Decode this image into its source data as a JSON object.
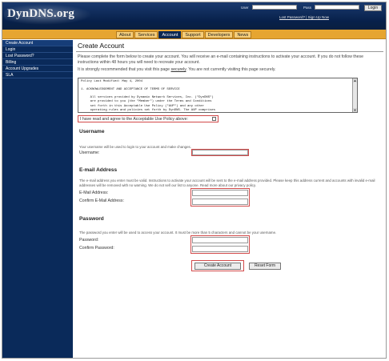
{
  "header": {
    "logo": "DynDNS.org",
    "login": {
      "user_label": "User",
      "pass_label": "Pass",
      "login_button": "Login",
      "links": "Lost Password? | Sign Up Now"
    }
  },
  "nav": {
    "tabs": [
      "About",
      "Services",
      "Account",
      "Support",
      "Developers",
      "News"
    ],
    "active": "Account"
  },
  "sidebar": {
    "items": [
      "Create Account",
      "Login",
      "Lost Password?",
      "Billing",
      "Account Upgrades",
      "SLA"
    ]
  },
  "main": {
    "title": "Create Account",
    "intro": "Please complete the form below to create your account. You will receive an e-mail containing instructions to activate your account. If you do not follow these instructions within 48 hours you will need to recreate your account.",
    "secure_before": "It is strongly recommended that you visit this page ",
    "secure_link": "securely",
    "secure_after": ". You are not currently visiting this page securely.",
    "policy_lines": [
      "Policy Last Modified: May 4, 2004",
      "",
      "1. ACKNOWLEDGEMENT AND ACCEPTANCE OF TERMS OF SERVICE",
      "",
      "     All services provided by Dynamic Network Services, Inc. (\"DynDNS\")",
      "     are provided to you (the \"Member\") under the Terms and Conditions",
      "     set forth in this Acceptable Use Policy (\"AUP\") and any other",
      "     operating rules and policies set forth by DynDNS. The AUP comprises"
    ],
    "agree_label": "I have read and agree to the Acceptable Use Policy above:",
    "username": {
      "heading": "Username",
      "desc": "Your username will be used to login to your account and make changes.",
      "label": "Username:"
    },
    "email": {
      "heading": "E-mail Address",
      "desc": "The e-mail address you enter must be valid. Instructions to activate your account will be sent to the e-mail address provided. Please keep this address current and accounts with invalid e-mail addresses will be removed with no warning. We do not sell our list to anyone. Read more about our privacy policy.",
      "label": "E-Mail Address:",
      "confirm_label": "Confirm E-Mail Address:"
    },
    "password": {
      "heading": "Password",
      "desc": "The password you enter will be used to access your account. It must be more than 5 characters and cannot be your username.",
      "label": "Password:",
      "confirm_label": "Confirm Password:"
    },
    "buttons": {
      "create": "Create Account",
      "reset": "Reset Form"
    }
  },
  "colors": {
    "header_bg": "#07204a",
    "nav_bg": "#e6a531",
    "sidebar_bg": "#0a2a5a",
    "highlight": "#d24a4a"
  },
  "icons": [
    "scroll-up-arrow-icon",
    "scroll-down-arrow-icon"
  ]
}
